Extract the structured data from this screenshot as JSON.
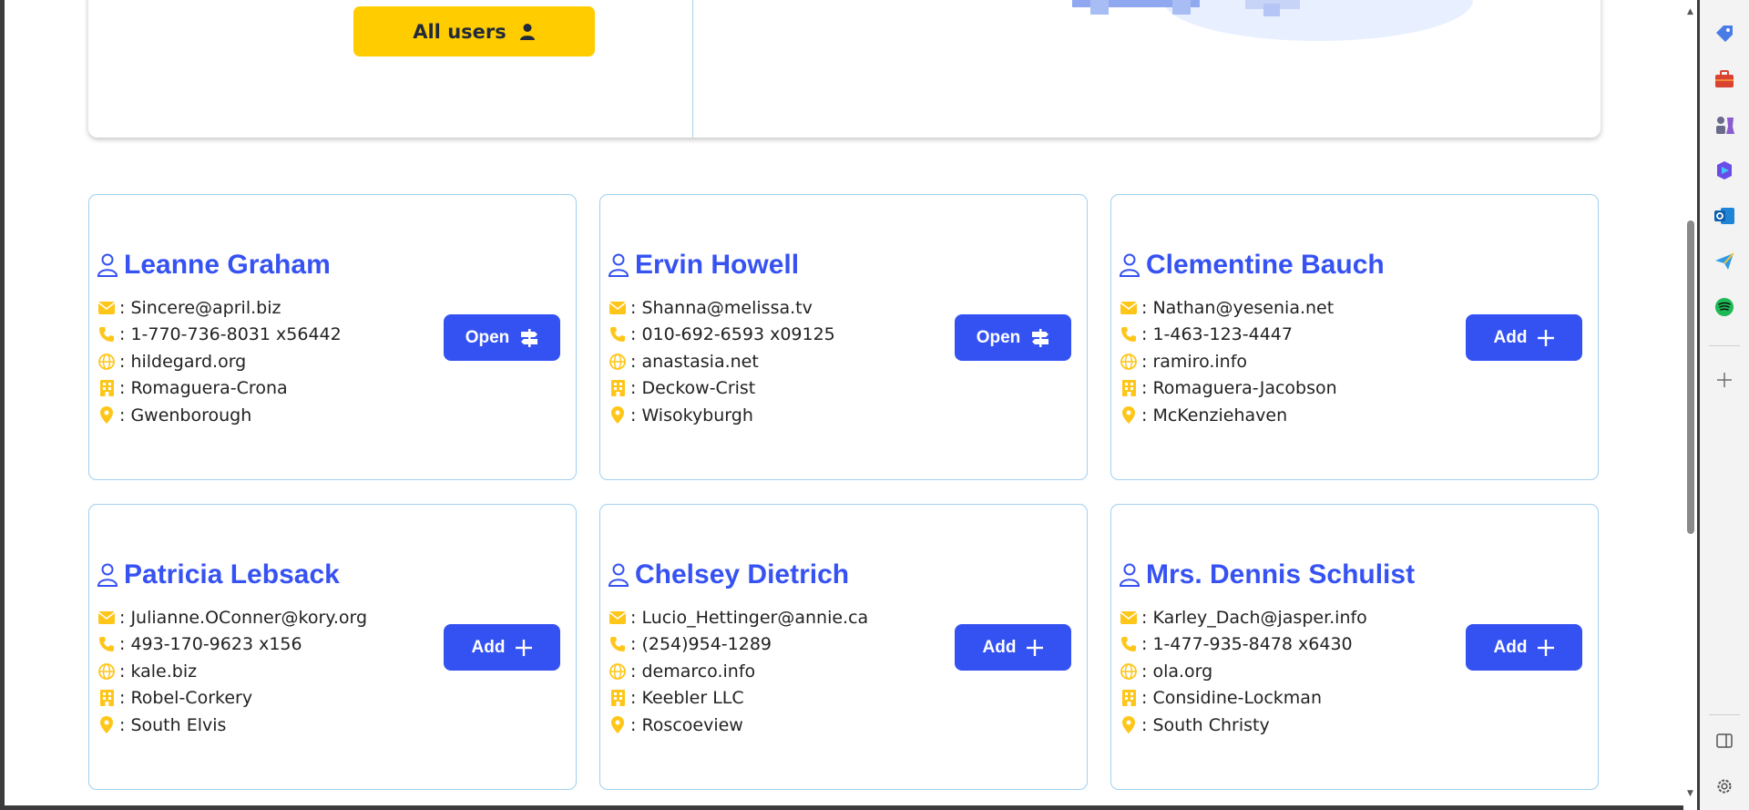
{
  "header": {
    "all_users_label": "All users"
  },
  "users": [
    {
      "name": "Leanne Graham",
      "email": ": Sincere@april.biz",
      "phone": ": 1-770-736-8031 x56442",
      "website": ": hildegard.org",
      "company": ": Romaguera-Crona",
      "city": ": Gwenborough",
      "action": "Open",
      "action_icon": "signpost-icon"
    },
    {
      "name": "Ervin Howell",
      "email": ": Shanna@melissa.tv",
      "phone": ": 010-692-6593 x09125",
      "website": ": anastasia.net",
      "company": ": Deckow-Crist",
      "city": ": Wisokyburgh",
      "action": "Open",
      "action_icon": "signpost-icon"
    },
    {
      "name": "Clementine Bauch",
      "email": ": Nathan@yesenia.net",
      "phone": ": 1-463-123-4447",
      "website": ": ramiro.info",
      "company": ": Romaguera-Jacobson",
      "city": ": McKenziehaven",
      "action": "Add",
      "action_icon": "plus-icon"
    },
    {
      "name": "Patricia Lebsack",
      "email": ": Julianne.OConner@kory.org",
      "phone": ": 493-170-9623 x156",
      "website": ": kale.biz",
      "company": ": Robel-Corkery",
      "city": ": South Elvis",
      "action": "Add",
      "action_icon": "plus-icon"
    },
    {
      "name": "Chelsey Dietrich",
      "email": ": Lucio_Hettinger@annie.ca",
      "phone": ": (254)954-1289",
      "website": ": demarco.info",
      "company": ": Keebler LLC",
      "city": ": Roscoeview",
      "action": "Add",
      "action_icon": "plus-icon"
    },
    {
      "name": "Mrs. Dennis Schulist",
      "email": ": Karley_Dach@jasper.info",
      "phone": ": 1-477-935-8478 x6430",
      "website": ": ola.org",
      "company": ": Considine-Lockman",
      "city": ": South Christy",
      "action": "Add",
      "action_icon": "plus-icon"
    }
  ],
  "colors": {
    "accent_blue": "#3452f2",
    "accent_yellow": "#ffcc00",
    "card_border": "#9fd0f0"
  },
  "sidebar": {
    "icons": [
      "tag-icon",
      "toolbox-icon",
      "chess-icon",
      "copilot-icon",
      "outlook-icon",
      "send-icon",
      "spotify-icon",
      "add-icon",
      "split-view-icon",
      "settings-icon"
    ]
  }
}
